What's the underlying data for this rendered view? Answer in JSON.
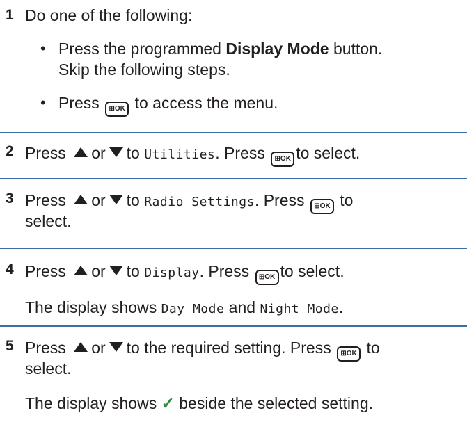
{
  "steps": [
    {
      "number": "1",
      "intro": "Do one of the following:",
      "bullets": {
        "b1_pre": "Press the programmed ",
        "b1_bold": "Display Mode",
        "b1_post": " button.",
        "b1_line2": "Skip the following steps.",
        "b2_pre": "Press",
        "b2_post": "to access the menu."
      }
    },
    {
      "number": "2",
      "press": "Press",
      "or": "or",
      "to": "to",
      "menu_item": "Utilities",
      "press2": ". Press",
      "select": "to select."
    },
    {
      "number": "3",
      "press": "Press",
      "or": "or",
      "to": "to",
      "menu_item": "Radio Settings",
      "press2": ". Press",
      "to_word": "to",
      "select_line2": "select."
    },
    {
      "number": "4",
      "press": "Press",
      "or": "or",
      "to": "to",
      "menu_item": "Display",
      "press2": ". Press",
      "select": "to select.",
      "result_pre": "The display shows ",
      "result_mode1": "Day Mode",
      "result_and": " and ",
      "result_mode2": "Night Mode",
      "result_end": "."
    },
    {
      "number": "5",
      "press": "Press",
      "or": "or",
      "to_setting": "to the required setting. Press",
      "to_word": "to",
      "select_line2": "select.",
      "result_pre": "The display shows ",
      "check_glyph": "✓",
      "result_post": " beside the selected setting."
    }
  ],
  "okkey_label": "⊞OK",
  "icons": {
    "up": "up-triangle-icon",
    "down": "down-triangle-icon",
    "ok": "menu-ok-button-icon",
    "check": "checkmark-icon"
  },
  "colors": {
    "separator": "#3a6ea5",
    "check": "#2f8f3a"
  }
}
